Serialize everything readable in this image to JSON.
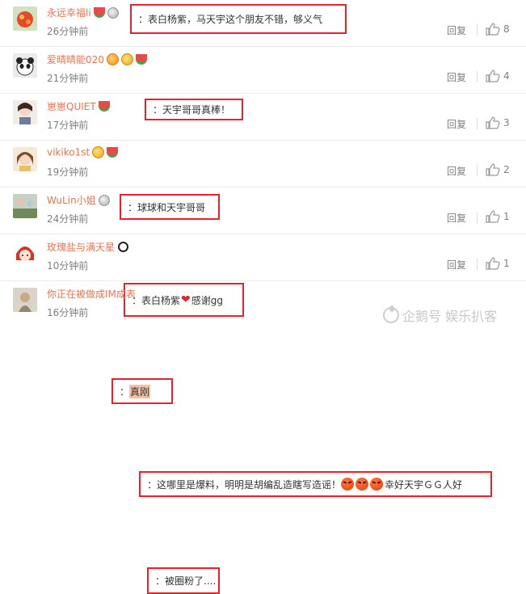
{
  "comments": [
    {
      "user": "永远幸福li",
      "time": "26分钟前",
      "reply_label": "回复",
      "likes": "8",
      "text": "表白杨紫，马天宇这个朋友不错，够义气"
    },
    {
      "user": "爱晴晴能020",
      "time": "21分钟前",
      "reply_label": "回复",
      "likes": "4",
      "text": "天宇哥哥真棒！"
    },
    {
      "user": "崽崽QUIET",
      "time": "17分钟前",
      "reply_label": "回复",
      "likes": "3",
      "text": "球球和天宇哥哥"
    },
    {
      "user": "vikiko1st",
      "time": "19分钟前",
      "reply_label": "回复",
      "likes": "2",
      "text_before": "表白杨紫",
      "text_after": "感谢gg"
    },
    {
      "user": "WuLin小姐",
      "time": "24分钟前",
      "reply_label": "回复",
      "likes": "1",
      "text": "真刚"
    },
    {
      "user": "玫瑰盐与满天星",
      "time": "10分钟前",
      "reply_label": "回复",
      "likes": "1",
      "text_before": "这哪里是爆料，明明是胡编乱造瞎写造谣！",
      "text_after": "幸好天宇ＧＧ人好"
    },
    {
      "user": "你正在被做成IM成表",
      "time": "16分钟前",
      "reply_label": "回复",
      "likes": "",
      "text": "被圈粉了...."
    }
  ],
  "colon": "：",
  "watermark": {
    "text": "企鹅号 娱乐扒客"
  },
  "colors": {
    "username": "#eb7350",
    "highlight_box": "#e8222c",
    "meta": "#808080"
  }
}
